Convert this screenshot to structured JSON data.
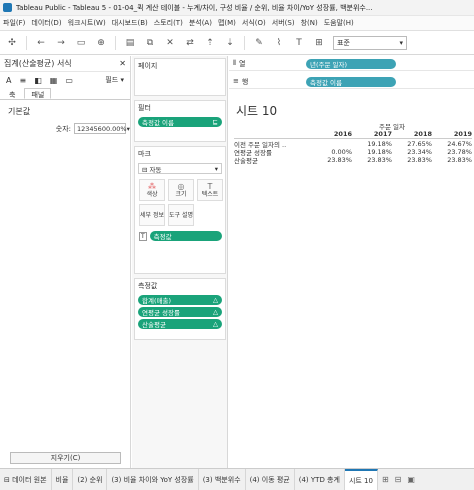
{
  "window": {
    "title": "Tableau Public - Tableau 5 - 01-04_퀵 계산 테이블 - 누계/차이, 구성 비율 / 순위, 비율 차이/YoY 성장률, 백분위수..."
  },
  "menu": [
    "파일(F)",
    "데이터(D)",
    "워크시트(W)",
    "대시보드(B)",
    "스토리(T)",
    "분석(A)",
    "맵(M)",
    "서식(O)",
    "서버(S)",
    "창(N)",
    "도움말(H)"
  ],
  "toolbar": {
    "fit_value": "표준"
  },
  "format_pane": {
    "title": "집계(산술평균) 서식",
    "fields_label": "필드",
    "tab_axis": "축",
    "tab_pane": "패널",
    "section": "기본값",
    "number_label": "숫자:",
    "number_value": "12345600.00%",
    "clear_label": "지우기(C)"
  },
  "shelves": {
    "pages_label": "페이지",
    "filters_label": "필터",
    "filter_pill": "측정값 이름",
    "marks_label": "마크",
    "marks_type": "자동",
    "mark_buttons": {
      "color": "색상",
      "size": "크기",
      "text": "텍스트",
      "detail": "세부 정보",
      "tooltip": "도구 설명"
    },
    "marks_pill": "측정값",
    "measure_values_label": "측정값",
    "measure_pills": [
      "합계(매출)",
      "연평균 성장률",
      "산술평균"
    ],
    "columns_label": "열",
    "columns_pill": "년(주문 일자)",
    "rows_label": "행",
    "rows_pill": "측정값 이름"
  },
  "view": {
    "sheet_title": "시트 10",
    "header_field": "주문 일자",
    "years": [
      "2016",
      "2017",
      "2018",
      "2019"
    ],
    "rows": [
      {
        "label": "이전 주문 일자의 ..",
        "values": [
          "",
          "19.18%",
          "27.65%",
          "24.67%"
        ]
      },
      {
        "label": "연평균 성장률",
        "values": [
          "0.00%",
          "19.18%",
          "23.34%",
          "23.78%"
        ]
      },
      {
        "label": "산술평균",
        "values": [
          "23.83%",
          "23.83%",
          "23.83%",
          "23.83%"
        ]
      }
    ]
  },
  "tabs": {
    "datasource": "데이터 원본",
    "sheets": [
      "비율",
      "(2) 순위",
      "(3) 비율 차이와 YoY 성장률",
      "(3) 백분위수",
      "(4) 이동 평균",
      "(4) YTD 총계",
      "시트 10"
    ],
    "active_index": 6
  }
}
